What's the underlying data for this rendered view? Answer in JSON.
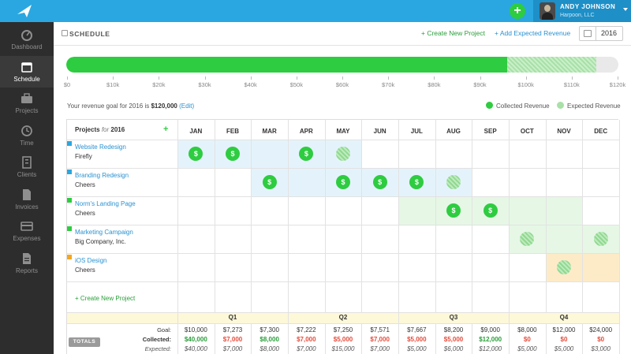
{
  "topbar": {
    "user_name": "ANDY JOHNSON",
    "user_company": "Harpoon, LLC"
  },
  "sidebar": {
    "items": [
      {
        "label": "Dashboard",
        "icon": "dashboard-icon"
      },
      {
        "label": "Schedule",
        "icon": "calendar-icon",
        "active": true
      },
      {
        "label": "Projects",
        "icon": "briefcase-icon"
      },
      {
        "label": "Time",
        "icon": "clock-icon"
      },
      {
        "label": "Clients",
        "icon": "building-icon"
      },
      {
        "label": "Invoices",
        "icon": "document-icon"
      },
      {
        "label": "Expenses",
        "icon": "credit-card-icon"
      },
      {
        "label": "Reports",
        "icon": "report-icon"
      }
    ]
  },
  "header": {
    "title": "SCHEDULE",
    "create_project": "+ Create New Project",
    "add_revenue": "+ Add Expected Revenue",
    "year": "2016"
  },
  "progress": {
    "collected_fraction": 0.799,
    "expected_fraction": 0.96,
    "ticks": [
      "$0",
      "$10k",
      "$20k",
      "$30k",
      "$40k",
      "$50k",
      "$60k",
      "$70k",
      "$80k",
      "$90k",
      "$100k",
      "$110k",
      "$120k"
    ]
  },
  "goal": {
    "prefix": "Your revenue goal for 2016 is",
    "amount": "$120,000",
    "edit": "(Edit)"
  },
  "legend": {
    "collected": "Collected Revenue",
    "expected": "Expected Revenue"
  },
  "table": {
    "projects_label": "Projects",
    "for_label": "for",
    "year": "2016",
    "months": [
      "JAN",
      "FEB",
      "MAR",
      "APR",
      "MAY",
      "JUN",
      "JUL",
      "AUG",
      "SEP",
      "OCT",
      "NOV",
      "DEC"
    ],
    "create_link": "+ Create New Project",
    "pay_symbol": "$",
    "projects": [
      {
        "name": "Website Redesign",
        "client": "Firefly",
        "color": "#2aa7e0",
        "span_color": "#e4f3fb",
        "span": [
          0,
          4
        ],
        "paid": [
          0,
          1,
          3
        ],
        "expected": [
          4
        ]
      },
      {
        "name": "Branding Redesign",
        "client": "Cheers",
        "color": "#2aa7e0",
        "span_color": "#e4f3fb",
        "span": [
          2,
          7
        ],
        "paid": [
          2,
          4,
          5,
          6
        ],
        "expected": [
          7
        ]
      },
      {
        "name": "Norm's Landing Page",
        "client": "Cheers",
        "color": "#2ecc40",
        "span_color": "#e6f7e6",
        "span": [
          6,
          10
        ],
        "paid": [
          7,
          8
        ],
        "expected": []
      },
      {
        "name": "Marketing Campaign",
        "client": "Big Company, Inc.",
        "color": "#2ecc40",
        "span_color": "#e6f7e6",
        "span": [
          9,
          11
        ],
        "paid": [],
        "expected": [
          9,
          11
        ]
      },
      {
        "name": "iOS Design",
        "client": "Cheers",
        "color": "#f5a623",
        "span_color": "#fdebc8",
        "span": [
          10,
          11
        ],
        "paid": [],
        "expected": [
          10
        ]
      }
    ],
    "quarters": [
      "Q1",
      "Q2",
      "Q3",
      "Q4"
    ],
    "totals_label": "TOTALS",
    "goal_label": "Goal:",
    "collected_label": "Collected:",
    "expected_label": "Expected:",
    "goal_values": [
      "$10,000",
      "$7,273",
      "$7,300",
      "$7,222",
      "$7,250",
      "$7,571",
      "$7,667",
      "$8,200",
      "$9,000",
      "$8,000",
      "$12,000",
      "$24,000"
    ],
    "collected_values": [
      "$40,000",
      "$7,000",
      "$8,000",
      "$7,000",
      "$5,000",
      "$7,000",
      "$5,000",
      "$5,000",
      "$12,000",
      "$0",
      "$0",
      "$0"
    ],
    "collected_colors": [
      "#2a9e3a",
      "#e74c3c",
      "#2a9e3a",
      "#e74c3c",
      "#e74c3c",
      "#e74c3c",
      "#e74c3c",
      "#e74c3c",
      "#2a9e3a",
      "#e74c3c",
      "#e74c3c",
      "#e74c3c"
    ],
    "expected_values": [
      "$40,000",
      "$7,000",
      "$8,000",
      "$7,000",
      "$15,000",
      "$7,000",
      "$5,000",
      "$6,000",
      "$12,000",
      "$5,000",
      "$5,000",
      "$3,000"
    ]
  }
}
